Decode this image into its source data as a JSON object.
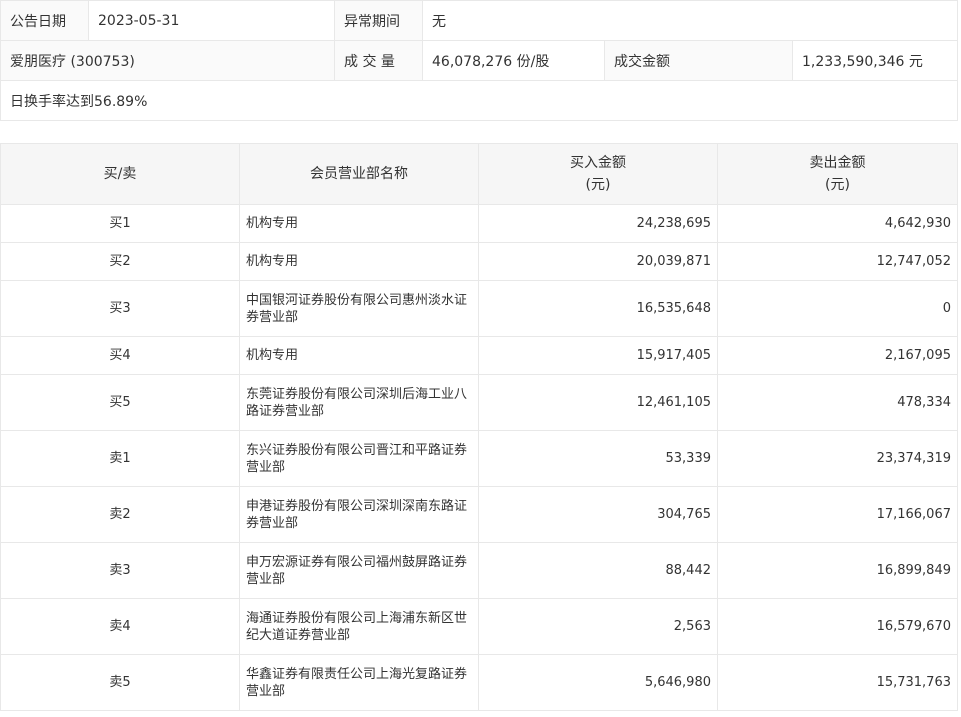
{
  "summary": {
    "date_label": "公告日期",
    "date_value": "2023-05-31",
    "period_label": "异常期间",
    "period_value": "无",
    "stock_name": "爱朋医疗 (300753)",
    "volume_label": "成 交 量",
    "volume_value": "46,078,276 份/股",
    "amount_label": "成交金额",
    "amount_value": "1,233,590,346 元",
    "reason": "日换手率达到56.89%"
  },
  "table": {
    "headers": {
      "side": "买/卖",
      "member": "会员营业部名称",
      "buy_line1": "买入金额",
      "buy_line2": "(元)",
      "sell_line1": "卖出金额",
      "sell_line2": "(元)"
    },
    "rows": [
      {
        "side": "买1",
        "name": "机构专用",
        "buy": "24,238,695",
        "sell": "4,642,930"
      },
      {
        "side": "买2",
        "name": "机构专用",
        "buy": "20,039,871",
        "sell": "12,747,052"
      },
      {
        "side": "买3",
        "name": "中国银河证券股份有限公司惠州淡水证券营业部",
        "buy": "16,535,648",
        "sell": "0"
      },
      {
        "side": "买4",
        "name": "机构专用",
        "buy": "15,917,405",
        "sell": "2,167,095"
      },
      {
        "side": "买5",
        "name": "东莞证券股份有限公司深圳后海工业八路证券营业部",
        "buy": "12,461,105",
        "sell": "478,334"
      },
      {
        "side": "卖1",
        "name": "东兴证券股份有限公司晋江和平路证券营业部",
        "buy": "53,339",
        "sell": "23,374,319"
      },
      {
        "side": "卖2",
        "name": "申港证券股份有限公司深圳深南东路证券营业部",
        "buy": "304,765",
        "sell": "17,166,067"
      },
      {
        "side": "卖3",
        "name": "申万宏源证券有限公司福州鼓屏路证券营业部",
        "buy": "88,442",
        "sell": "16,899,849"
      },
      {
        "side": "卖4",
        "name": "海通证券股份有限公司上海浦东新区世纪大道证券营业部",
        "buy": "2,563",
        "sell": "16,579,670"
      },
      {
        "side": "卖5",
        "name": "华鑫证券有限责任公司上海光复路证券营业部",
        "buy": "5,646,980",
        "sell": "15,731,763"
      }
    ]
  }
}
